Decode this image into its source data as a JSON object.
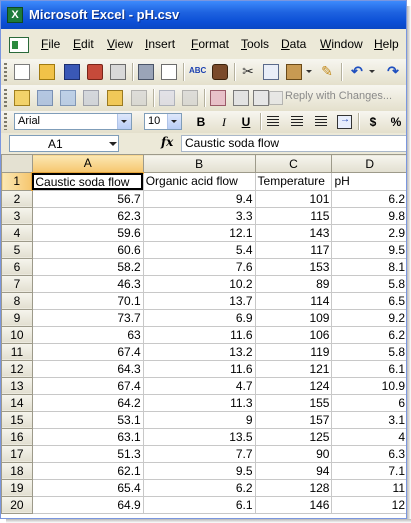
{
  "window": {
    "title": "Microsoft Excel - pH.csv"
  },
  "menu": {
    "items": [
      "File",
      "Edit",
      "View",
      "Insert",
      "Format",
      "Tools",
      "Data",
      "Window",
      "Help"
    ]
  },
  "toolbar2": {
    "reply_label": "Reply with Changes..."
  },
  "format_bar": {
    "font": "Arial",
    "size": "10",
    "bold": "B",
    "italic": "I",
    "underline": "U",
    "currency": "$",
    "percent": "%"
  },
  "formula_bar": {
    "cell_ref": "A1",
    "fx": "fx",
    "content": "Caustic soda flow"
  },
  "sheet": {
    "columns": [
      "A",
      "B",
      "C",
      "D"
    ],
    "rows": [
      {
        "n": "1",
        "a": "Caustic soda flow",
        "b": "Organic acid flow",
        "c": "Temperature",
        "d": "pH"
      },
      {
        "n": "2",
        "a": "56.7",
        "b": "9.4",
        "c": "101",
        "d": "6.2"
      },
      {
        "n": "3",
        "a": "62.3",
        "b": "3.3",
        "c": "115",
        "d": "9.8"
      },
      {
        "n": "4",
        "a": "59.6",
        "b": "12.1",
        "c": "143",
        "d": "2.9"
      },
      {
        "n": "5",
        "a": "60.6",
        "b": "5.4",
        "c": "117",
        "d": "9.5"
      },
      {
        "n": "6",
        "a": "58.2",
        "b": "7.6",
        "c": "153",
        "d": "8.1"
      },
      {
        "n": "7",
        "a": "46.3",
        "b": "10.2",
        "c": "89",
        "d": "5.8"
      },
      {
        "n": "8",
        "a": "70.1",
        "b": "13.7",
        "c": "114",
        "d": "6.5"
      },
      {
        "n": "9",
        "a": "73.7",
        "b": "6.9",
        "c": "109",
        "d": "9.2"
      },
      {
        "n": "10",
        "a": "63",
        "b": "11.6",
        "c": "106",
        "d": "6.2"
      },
      {
        "n": "11",
        "a": "67.4",
        "b": "13.2",
        "c": "119",
        "d": "5.8"
      },
      {
        "n": "12",
        "a": "64.3",
        "b": "11.6",
        "c": "121",
        "d": "6.1"
      },
      {
        "n": "13",
        "a": "67.4",
        "b": "4.7",
        "c": "124",
        "d": "10.9"
      },
      {
        "n": "14",
        "a": "64.2",
        "b": "11.3",
        "c": "155",
        "d": "6"
      },
      {
        "n": "15",
        "a": "53.1",
        "b": "9",
        "c": "157",
        "d": "3.1"
      },
      {
        "n": "16",
        "a": "63.1",
        "b": "13.5",
        "c": "125",
        "d": "4"
      },
      {
        "n": "17",
        "a": "51.3",
        "b": "7.7",
        "c": "90",
        "d": "6.3"
      },
      {
        "n": "18",
        "a": "62.1",
        "b": "9.5",
        "c": "94",
        "d": "7.1"
      },
      {
        "n": "19",
        "a": "65.4",
        "b": "6.2",
        "c": "128",
        "d": "11"
      },
      {
        "n": "20",
        "a": "64.9",
        "b": "6.1",
        "c": "146",
        "d": "12"
      }
    ]
  }
}
